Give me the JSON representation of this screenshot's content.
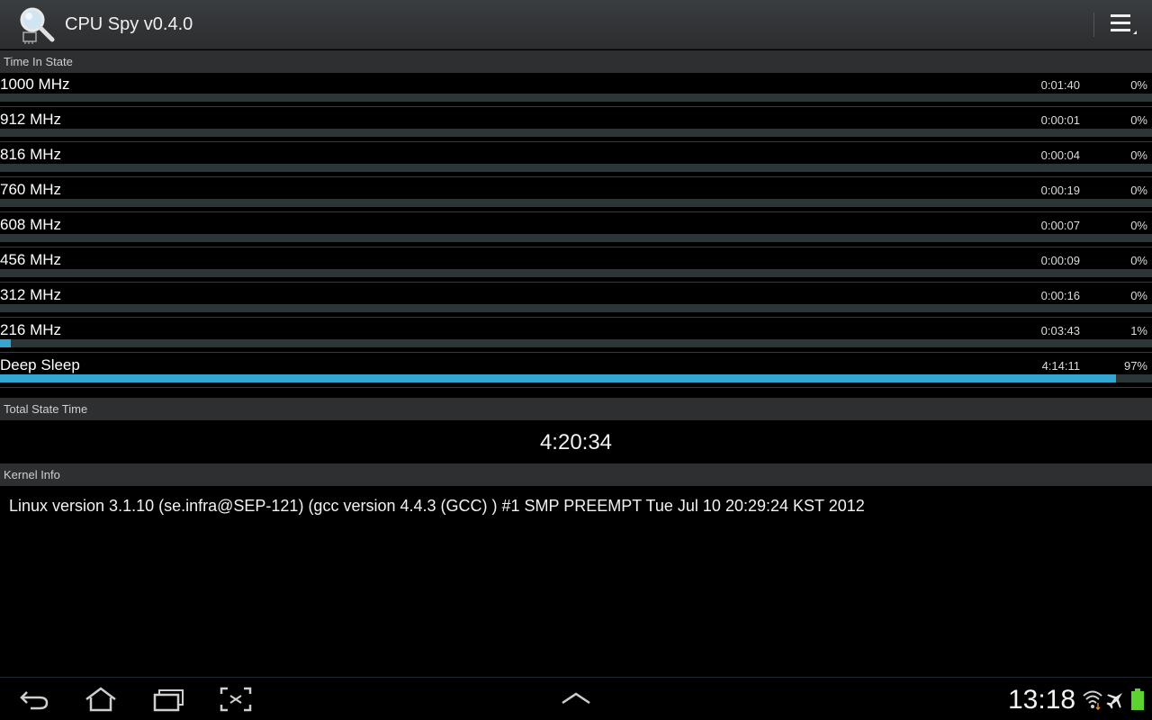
{
  "app": {
    "title": "CPU Spy v0.4.0",
    "icon": "magnifier-chip-icon",
    "menu_icon": "overflow-menu-icon"
  },
  "sections": {
    "time_in_state": "Time In State",
    "total_state_time": "Total State Time",
    "kernel_info": "Kernel Info"
  },
  "states": [
    {
      "name": "1000 MHz",
      "time": "0:01:40",
      "percent": "0%",
      "fraction": 0.0
    },
    {
      "name": "912 MHz",
      "time": "0:00:01",
      "percent": "0%",
      "fraction": 0.0
    },
    {
      "name": "816 MHz",
      "time": "0:00:04",
      "percent": "0%",
      "fraction": 0.0
    },
    {
      "name": "760 MHz",
      "time": "0:00:19",
      "percent": "0%",
      "fraction": 0.0
    },
    {
      "name": "608 MHz",
      "time": "0:00:07",
      "percent": "0%",
      "fraction": 0.0
    },
    {
      "name": "456 MHz",
      "time": "0:00:09",
      "percent": "0%",
      "fraction": 0.0
    },
    {
      "name": "312 MHz",
      "time": "0:00:16",
      "percent": "0%",
      "fraction": 0.0
    },
    {
      "name": "216 MHz",
      "time": "0:03:43",
      "percent": "1%",
      "fraction": 0.009
    },
    {
      "name": "Deep Sleep",
      "time": "4:14:11",
      "percent": "97%",
      "fraction": 0.97
    }
  ],
  "total_state_time": "4:20:34",
  "kernel_info": "Linux version 3.1.10 (se.infra@SEP-121) (gcc version 4.4.3 (GCC) ) #1 SMP PREEMPT Tue Jul 10 20:29:24 KST 2012",
  "navbar": {
    "buttons": [
      "back-icon",
      "home-icon",
      "recent-apps-icon",
      "screenshot-icon",
      "up-chevron-icon"
    ],
    "clock": "13:18",
    "status_icons": [
      "wifi-icon",
      "airplane-mode-icon",
      "battery-icon"
    ]
  },
  "colors": {
    "accent": "#33a6d2",
    "bar_track": "#2c3538",
    "section_header_bg": "#2d2f31",
    "battery": "#5cd12f"
  }
}
